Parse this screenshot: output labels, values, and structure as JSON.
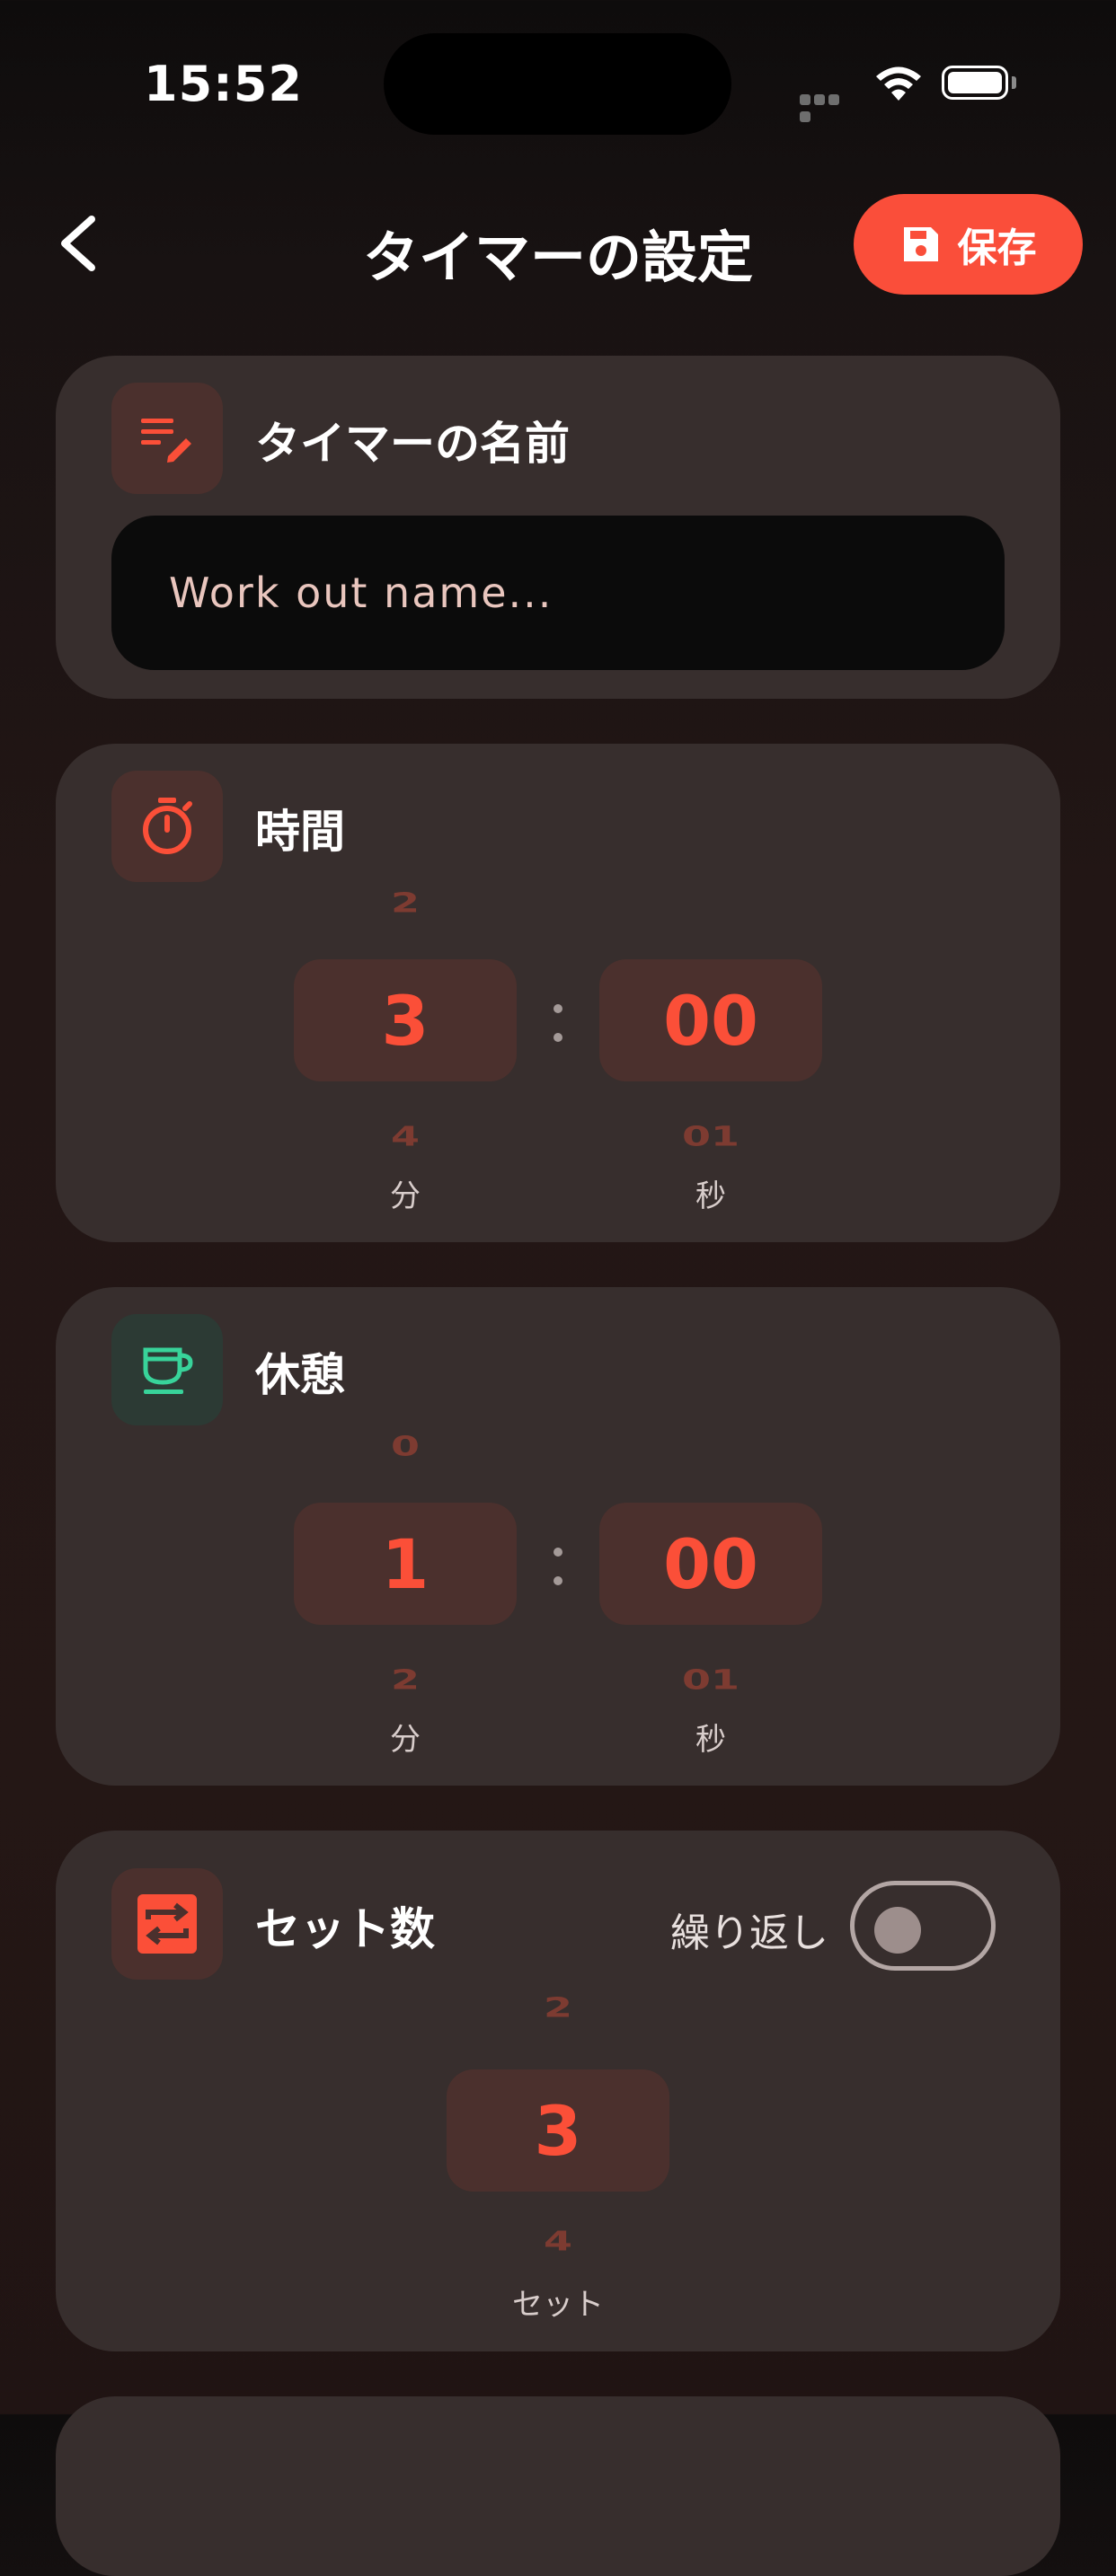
{
  "status_bar": {
    "time": "15:52"
  },
  "header": {
    "title": "タイマーの設定",
    "save_label": "保存"
  },
  "name_card": {
    "title": "タイマーの名前",
    "input_value": "",
    "input_placeholder": "Work out name..."
  },
  "duration_card": {
    "title": "時間",
    "minutes": {
      "prev": "2",
      "selected": "3",
      "next": "4",
      "unit": "分"
    },
    "seconds": {
      "prev": "",
      "selected": "00",
      "next": "01",
      "unit": "秒"
    }
  },
  "rest_card": {
    "title": "休憩",
    "minutes": {
      "prev": "0",
      "selected": "1",
      "next": "2",
      "unit": "分"
    },
    "seconds": {
      "prev": "",
      "selected": "00",
      "next": "01",
      "unit": "秒"
    }
  },
  "sets_card": {
    "title": "セット数",
    "repeat_label": "繰り返し",
    "repeat_enabled": false,
    "sets": {
      "prev": "2",
      "selected": "3",
      "next": "4",
      "unit": "セット"
    }
  },
  "colors": {
    "accent": "#fa4e3a",
    "card": "#372e2d",
    "icon_tint_red": "#fb4f38",
    "icon_tint_green": "#38d39a"
  }
}
